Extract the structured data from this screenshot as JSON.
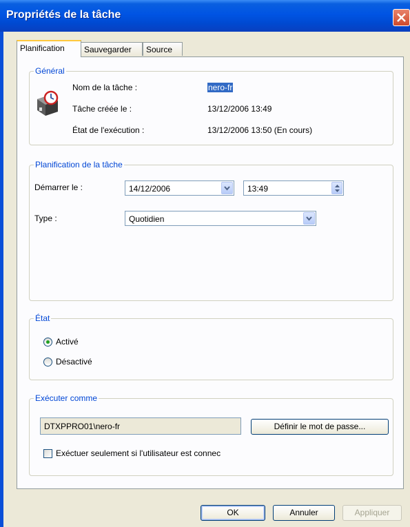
{
  "window": {
    "title": "Propriétés de la tâche"
  },
  "tabs": [
    "Planification",
    "Sauvegarder",
    "Source"
  ],
  "general": {
    "legend": "Général",
    "rows": [
      {
        "label": "Nom de la tâche :",
        "value": "nero-fr"
      },
      {
        "label": "Tâche créée le :",
        "value": "13/12/2006 13:49"
      },
      {
        "label": "État de l'exécution :",
        "value": "13/12/2006 13:50 (En cours)"
      }
    ]
  },
  "schedule": {
    "legend": "Planification de la tâche",
    "start_label": "Démarrer le :",
    "start_date": "14/12/2006",
    "start_time": "13:49",
    "type_label": "Type :",
    "type_value": "Quotidien"
  },
  "state": {
    "legend": "État",
    "options": [
      "Activé",
      "Désactivé"
    ],
    "selected": "Activé"
  },
  "run_as": {
    "legend": "Exécuter comme",
    "account": "DTXPPRO01\\nero-fr",
    "password_button": "Définir le mot de passe...",
    "only_logged_on_label": "Exéctuer seulement si l'utilisateur est connec",
    "only_logged_on_checked": false
  },
  "buttons": {
    "ok": "OK",
    "cancel": "Annuler",
    "apply": "Appliquer"
  }
}
